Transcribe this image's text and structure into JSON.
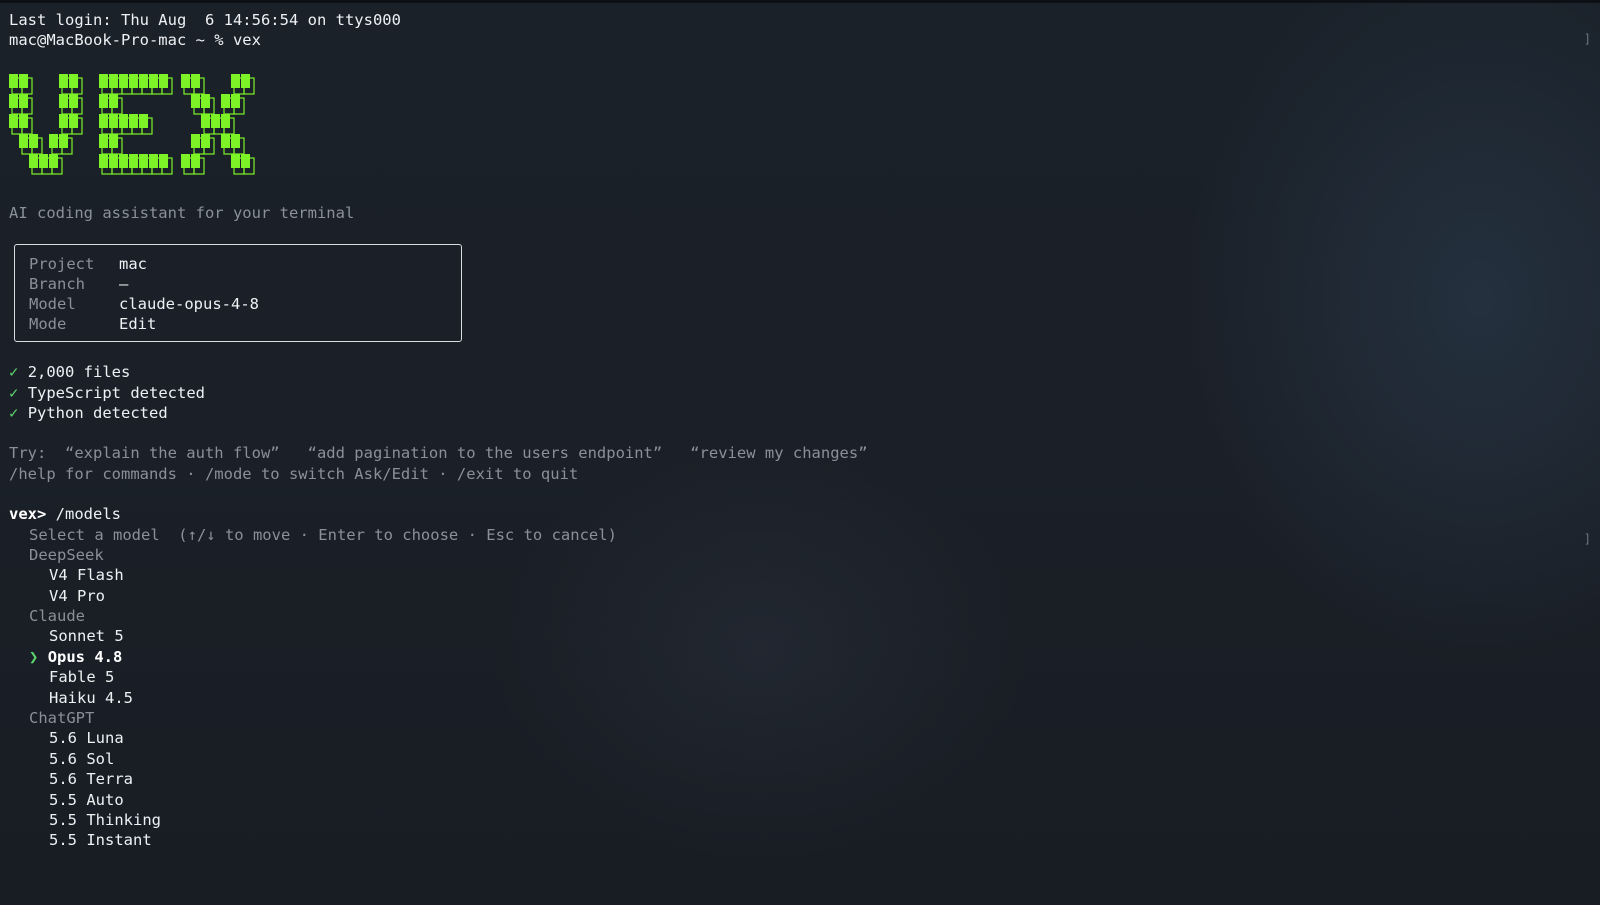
{
  "terminal": {
    "last_login": "Last login: Thu Aug  6 14:56:54 on ttys000",
    "prompt": "mac@MacBook-Pro-mac ~ % vex",
    "logo_text": "VEX",
    "tagline": "AI coding assistant for your terminal",
    "info": [
      {
        "key": "Project",
        "value": "mac"
      },
      {
        "key": "Branch",
        "value": "–"
      },
      {
        "key": "Model",
        "value": "claude-opus-4-8"
      },
      {
        "key": "Mode",
        "value": "Edit"
      }
    ],
    "checks": [
      "2,000 files",
      "TypeScript detected",
      "Python detected"
    ],
    "check_glyph": "✓",
    "try_line": "Try:  “explain the auth flow”   “add pagination to the users endpoint”   “review my changes”",
    "help_line": "/help for commands · /mode to switch Ask/Edit · /exit to quit",
    "vex_prompt": "vex>",
    "command": " /models",
    "select_hint": "Select a model  (↑/↓ to move · Enter to choose · Esc to cancel)",
    "selector_glyph": "❯",
    "groups": [
      {
        "name": "DeepSeek",
        "models": [
          "V4 Flash",
          "V4 Pro"
        ]
      },
      {
        "name": "Claude",
        "models": [
          "Sonnet 5",
          "Opus 4.8",
          "Fable 5",
          "Haiku 4.5"
        ]
      },
      {
        "name": "ChatGPT",
        "models": [
          "5.6 Luna",
          "5.6 Sol",
          "5.6 Terra",
          "5.5 Auto",
          "5.5 Thinking",
          "5.5 Instant"
        ]
      }
    ],
    "selected_model": "Opus 4.8"
  },
  "colors": {
    "background": "#1b2028",
    "logo_green": "#7cf227",
    "success_green": "#5cd46d",
    "dim_text": "#8a9099",
    "text": "#eef1f4"
  }
}
